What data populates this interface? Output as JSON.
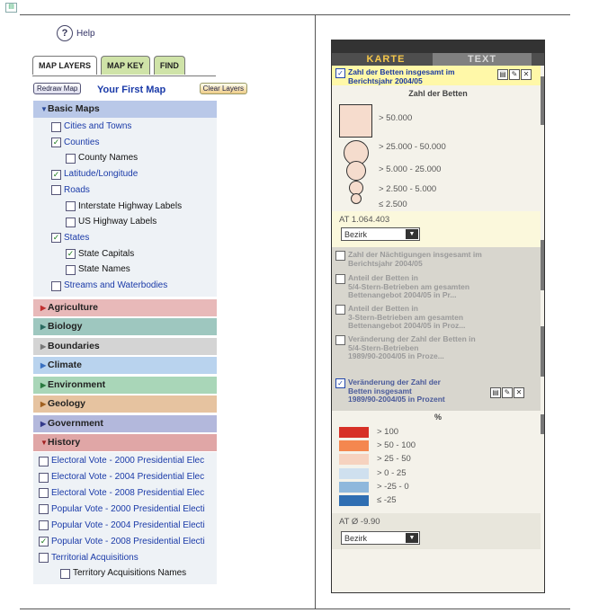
{
  "left": {
    "help_label": "Help",
    "tabs": [
      "MAP LAYERS",
      "MAP KEY",
      "FIND"
    ],
    "redraw_label": "Redraw Map",
    "map_title": "Your First Map",
    "clear_label": "Clear Layers",
    "basic_maps": {
      "title": "Basic Maps",
      "items": [
        {
          "label": "Cities and Towns",
          "checked": false,
          "indent": 0,
          "link": true
        },
        {
          "label": "Counties",
          "checked": true,
          "indent": 0,
          "link": true
        },
        {
          "label": "County Names",
          "checked": false,
          "indent": 1,
          "link": false
        },
        {
          "label": "Latitude/Longitude",
          "checked": true,
          "indent": 0,
          "link": true
        },
        {
          "label": "Roads",
          "checked": false,
          "indent": 0,
          "link": true
        },
        {
          "label": "Interstate Highway Labels",
          "checked": false,
          "indent": 1,
          "link": false
        },
        {
          "label": "US Highway Labels",
          "checked": false,
          "indent": 1,
          "link": false
        },
        {
          "label": "States",
          "checked": true,
          "indent": 0,
          "link": true
        },
        {
          "label": "State Capitals",
          "checked": true,
          "indent": 1,
          "link": false
        },
        {
          "label": "State Names",
          "checked": false,
          "indent": 1,
          "link": false
        },
        {
          "label": "Streams and Waterbodies",
          "checked": false,
          "indent": 0,
          "link": true
        }
      ]
    },
    "categories": [
      {
        "label": "Agriculture",
        "color": "#e8b9b9",
        "tri": "#c03030"
      },
      {
        "label": "Biology",
        "color": "#9ec7bf",
        "tri": "#2a6a60"
      },
      {
        "label": "Boundaries",
        "color": "#d4d4d4",
        "tri": "#777777"
      },
      {
        "label": "Climate",
        "color": "#b9d3ee",
        "tri": "#3a70c0"
      },
      {
        "label": "Environment",
        "color": "#a9d6b8",
        "tri": "#2a7a40"
      },
      {
        "label": "Geology",
        "color": "#e6c3a0",
        "tri": "#a06020"
      },
      {
        "label": "Government",
        "color": "#b3b8dc",
        "tri": "#333a8a"
      }
    ],
    "history": {
      "title": "History",
      "items": [
        {
          "label": "Electoral Vote - 2000 Presidential Elec",
          "checked": false,
          "indent": 0
        },
        {
          "label": "Electoral Vote - 2004 Presidential Elec",
          "checked": false,
          "indent": 0
        },
        {
          "label": "Electoral Vote - 2008 Presidential Elec",
          "checked": false,
          "indent": 0
        },
        {
          "label": "Popular Vote - 2000 Presidential Electi",
          "checked": false,
          "indent": 0
        },
        {
          "label": "Popular Vote - 2004 Presidential Electi",
          "checked": false,
          "indent": 0
        },
        {
          "label": "Popular Vote - 2008 Presidential Electi",
          "checked": true,
          "indent": 0
        },
        {
          "label": "Territorial Acquisitions",
          "checked": false,
          "indent": 0
        },
        {
          "label": "Territory Acquisitions Names",
          "checked": false,
          "indent": 1
        }
      ]
    }
  },
  "right": {
    "tab_karte": "KARTE",
    "tab_text": "TEXT",
    "layer1": {
      "line1": "Zahl der Betten insgesamt im",
      "line2": "Berichtsjahr 2004/05",
      "checked": true
    },
    "legend1_title": "Zahl der Betten",
    "legend1": [
      "> 50.000",
      "> 25.000 - 50.000",
      "> 5.000 - 25.000",
      "> 2.500 - 5.000",
      "≤ 2.500"
    ],
    "total1": "AT 1.064.403",
    "select1": "Bezirk",
    "grey_layers": [
      [
        "Zahl der Nächtigungen insgesamt im",
        "Berichtsjahr 2004/05"
      ],
      [
        "Anteil der Betten in",
        "5/4-Stern-Betrieben am gesamten",
        "Bettenangebot 2004/05 in Pr..."
      ],
      [
        "Anteil der Betten in",
        "3-Stern-Betrieben am gesamten",
        "Bettenangebot 2004/05 in Proz..."
      ],
      [
        "Veränderung der Zahl der Betten in",
        "5/4-Stern-Betrieben",
        "1989/90-2004/05 in Proze..."
      ]
    ],
    "layer2": {
      "lines": [
        "Veränderung der Zahl der",
        "Betten insgesamt",
        "1989/90-2004/05 in Prozent"
      ],
      "checked": true
    },
    "legend2_title": "%",
    "legend2": [
      {
        "label": "> 100",
        "color": "#d73027"
      },
      {
        "label": "> 50 - 100",
        "color": "#f4874f"
      },
      {
        "label": "> 25 - 50",
        "color": "#f6d2bf"
      },
      {
        "label": "> 0 - 25",
        "color": "#cfe0ef"
      },
      {
        "label": "> -25 - 0",
        "color": "#8fb8dc"
      },
      {
        "label": "≤ -25",
        "color": "#2f6eb2"
      }
    ],
    "total2": "AT Ø -9.90",
    "select2": "Bezirk"
  }
}
